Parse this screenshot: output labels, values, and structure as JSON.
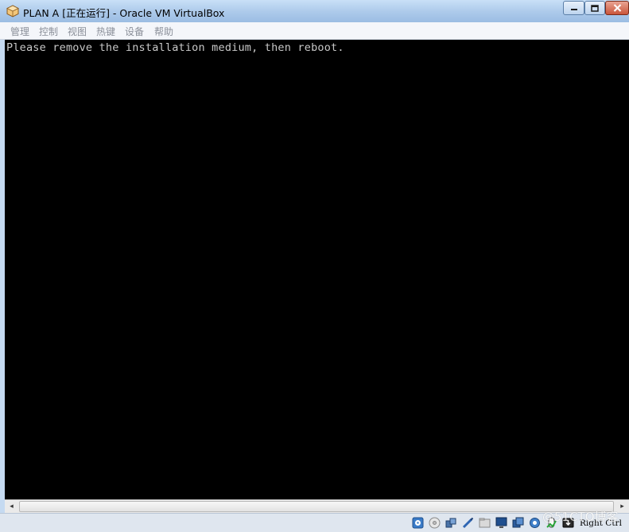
{
  "window": {
    "title": "PLAN A [正在运行] - Oracle VM VirtualBox",
    "icon": "virtualbox-cube-icon",
    "controls": {
      "minimize": "minimize-icon",
      "maximize": "maximize-icon",
      "close": "close-icon"
    }
  },
  "menubar": {
    "items": [
      {
        "label": "管理"
      },
      {
        "label": "控制"
      },
      {
        "label": "视图"
      },
      {
        "label": "热键"
      },
      {
        "label": "设备"
      },
      {
        "label": "帮助"
      }
    ]
  },
  "console": {
    "lines": [
      "Please remove the installation medium, then reboot."
    ],
    "background": "#000000",
    "text_color": "#c8c8c8"
  },
  "scrollbar": {
    "left_arrow": "◂",
    "right_arrow": "▸"
  },
  "statusbar": {
    "icons": [
      "hard-disk-icon",
      "optical-drive-icon",
      "audio-icon",
      "usb-icon",
      "shared-folders-icon",
      "display-icon",
      "video-capture-icon",
      "network-icon",
      "mouse-integration-icon"
    ],
    "host_key": "Right Ctrl"
  },
  "watermark": "@51CTO博客"
}
